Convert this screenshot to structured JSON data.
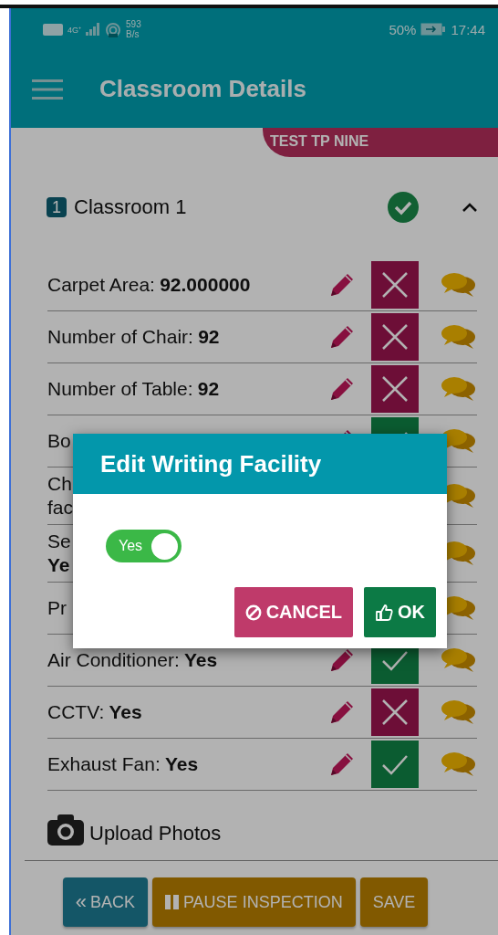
{
  "status_bar": {
    "network": "4G⁺",
    "speed": "593",
    "speed_unit": "B/s",
    "battery": "50%",
    "time": "17:44"
  },
  "app_bar": {
    "title": "Classroom Details"
  },
  "tag": "TEST TP NINE",
  "section": {
    "number": "1",
    "title": "Classroom 1",
    "expanded": true
  },
  "rows": [
    {
      "label": "Carpet Area:",
      "value": "92.000000",
      "kind": "cross"
    },
    {
      "label": "Number of Chair:",
      "value": "92",
      "kind": "cross"
    },
    {
      "label": "Number of Table:",
      "value": "92",
      "kind": "cross"
    },
    {
      "label": "Bo",
      "kind": "check"
    },
    {
      "label": "Ch",
      "label_2": "fac",
      "kind": "hidden"
    },
    {
      "label": "Se",
      "value_2": "Ye",
      "kind": "hidden"
    },
    {
      "label": "Pr",
      "kind": "hidden"
    },
    {
      "label": "Air Conditioner:",
      "value": "Yes",
      "kind": "check"
    },
    {
      "label": "CCTV:",
      "value": "Yes",
      "kind": "cross"
    },
    {
      "label": "Exhaust Fan:",
      "value": "Yes",
      "kind": "check"
    }
  ],
  "upload": "Upload Photos",
  "footer": [
    {
      "label": "BACK",
      "kind": "back",
      "icon": "«"
    },
    {
      "label": "PAUSE INSPECTION",
      "kind": "pause"
    },
    {
      "label": "SAVE",
      "kind": "save"
    }
  ],
  "dialog": {
    "title": "Edit Writing Facility",
    "toggle": {
      "label": "Yes",
      "on": true
    },
    "buttons": [
      {
        "label": "CANCEL",
        "kind": "cancel"
      },
      {
        "label": "OK",
        "kind": "ok"
      }
    ]
  }
}
